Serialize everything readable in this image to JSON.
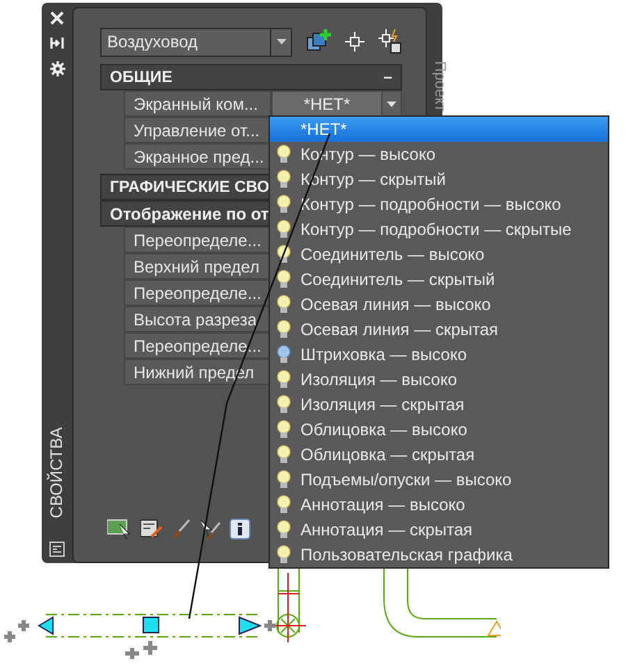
{
  "palette": {
    "title": "СВОЙСТВА",
    "side_tab": "Проект"
  },
  "selector": {
    "value": "Воздуховод"
  },
  "rows": [
    {
      "kind": "category",
      "label": "ОБЩИЕ",
      "toggle": "–"
    },
    {
      "kind": "property",
      "label": "Экранный ком...",
      "value": "*НЕТ*"
    },
    {
      "kind": "property",
      "label": "Управление от..."
    },
    {
      "kind": "property",
      "label": "Экранное пред..."
    },
    {
      "kind": "category",
      "label": "ГРАФИЧЕСКИЕ СВО"
    },
    {
      "kind": "subcategory",
      "label": "Отображение по от"
    },
    {
      "kind": "property",
      "label": "Переопределе..."
    },
    {
      "kind": "property",
      "label": "Верхний предел"
    },
    {
      "kind": "property",
      "label": "Переопределе..."
    },
    {
      "kind": "property",
      "label": "Высота разреза"
    },
    {
      "kind": "property",
      "label": "Переопределе..."
    },
    {
      "kind": "property",
      "label": "Нижний предел"
    }
  ],
  "dropdown": {
    "items": [
      {
        "label": "*НЕТ*",
        "selected": true
      },
      {
        "label": "Контур — высоко",
        "selected": false,
        "lit": true
      },
      {
        "label": "Контур — скрытый",
        "selected": false,
        "lit": true
      },
      {
        "label": "Контур — подробности — высоко",
        "selected": false,
        "lit": true
      },
      {
        "label": "Контур — подробности — скрытые",
        "selected": false,
        "lit": true
      },
      {
        "label": "Соединитель — высоко",
        "selected": false,
        "lit": true
      },
      {
        "label": "Соединитель — скрытый",
        "selected": false,
        "lit": true
      },
      {
        "label": "Осевая линия — высоко",
        "selected": false,
        "lit": true
      },
      {
        "label": "Осевая линия — скрытая",
        "selected": false,
        "lit": true
      },
      {
        "label": "Штриховка — высоко",
        "selected": false,
        "lit": false
      },
      {
        "label": "Изоляция — высоко",
        "selected": false,
        "lit": true
      },
      {
        "label": "Изоляция — скрытая",
        "selected": false,
        "lit": true
      },
      {
        "label": "Облицовка — высоко",
        "selected": false,
        "lit": true
      },
      {
        "label": "Облицовка — скрытая",
        "selected": false,
        "lit": true
      },
      {
        "label": "Подъемы/опуски — высоко",
        "selected": false,
        "lit": true
      },
      {
        "label": "Аннотация — высоко",
        "selected": false,
        "lit": true
      },
      {
        "label": "Аннотация — скрытая",
        "selected": false,
        "lit": true
      },
      {
        "label": "Пользовательская графика",
        "selected": false,
        "lit": true
      }
    ]
  }
}
